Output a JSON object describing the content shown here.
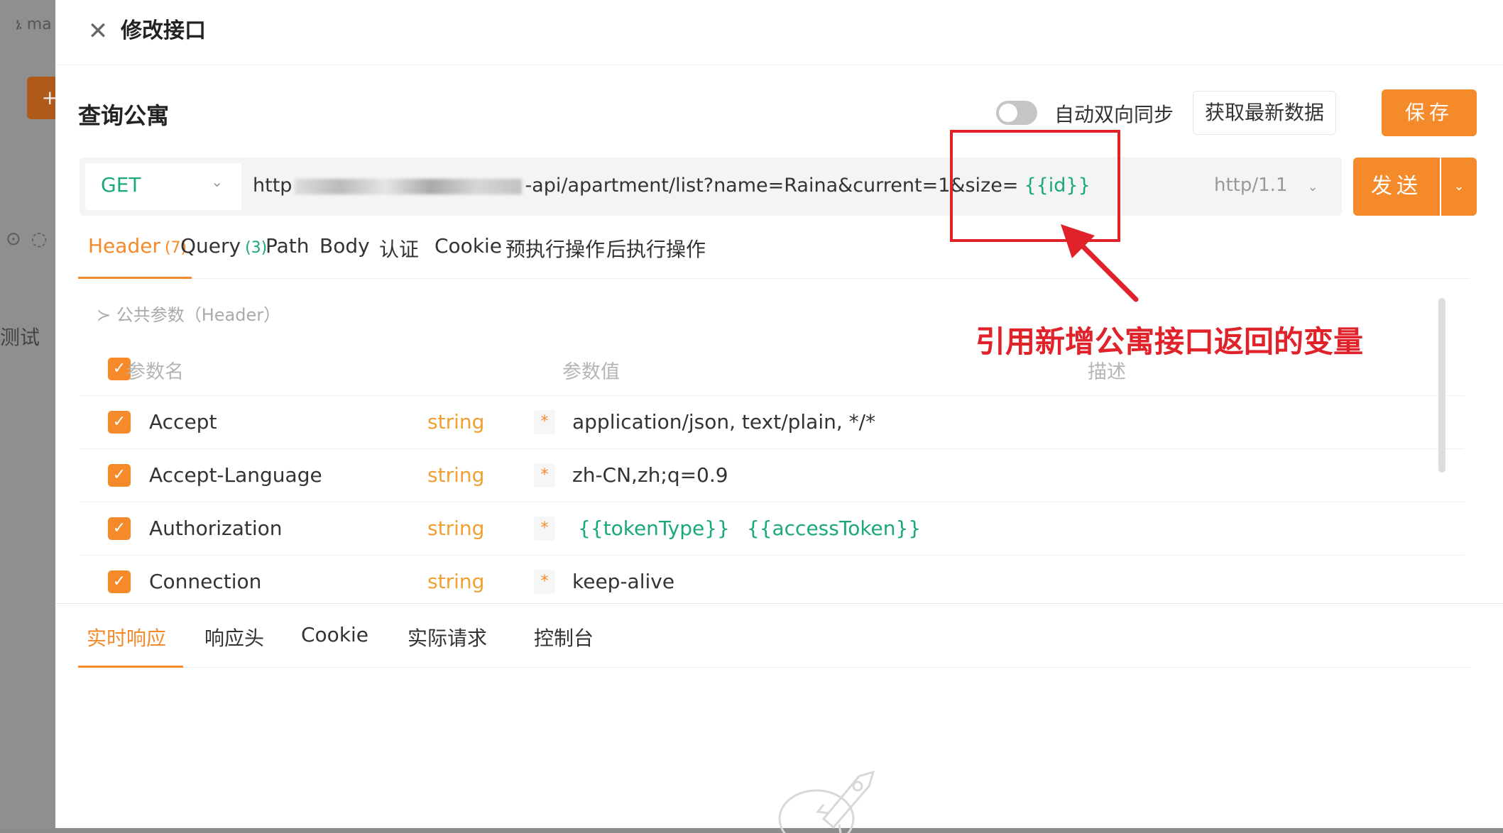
{
  "background": {
    "branch_label": "ma",
    "add_glyph": "+",
    "test_label": "测试",
    "icons": [
      "target-icon",
      "refresh-icon"
    ]
  },
  "drawer": {
    "title": "修改接口",
    "close_glyph": "✕"
  },
  "api": {
    "name": "查询公寓",
    "sync_label": "自动双向同步",
    "sync_on": false,
    "fetch_label": "获取最新数据",
    "save_label": "保存"
  },
  "request": {
    "method": "GET",
    "url_prefix": "http",
    "url_path": "-api/apartment/list?name=Raina&current=1&size=",
    "url_variable": "{{id}}",
    "http_version": "http/1.1",
    "send_label": "发送"
  },
  "tabs": [
    {
      "label": "Header",
      "count": "(7)",
      "active": true
    },
    {
      "label": "Query",
      "count": "(3)"
    },
    {
      "label": "Path"
    },
    {
      "label": "Body"
    },
    {
      "label": "认证"
    },
    {
      "label": "Cookie"
    },
    {
      "label": "预执行操作"
    },
    {
      "label": "后执行操作"
    }
  ],
  "common_params_label": "公共参数（Header）",
  "table": {
    "headers": {
      "name": "参数名",
      "value": "参数值",
      "desc": "描述"
    },
    "rows": [
      {
        "name": "Accept",
        "type": "string",
        "required": "*",
        "value": "application/json, text/plain, */*"
      },
      {
        "name": "Accept-Language",
        "type": "string",
        "required": "*",
        "value": "zh-CN,zh;q=0.9"
      },
      {
        "name": "Authorization",
        "type": "string",
        "required": "*",
        "value_vars": [
          "{{tokenType}}",
          "{{accessToken}}"
        ]
      },
      {
        "name": "Connection",
        "type": "string",
        "required": "*",
        "value": "keep-alive"
      }
    ]
  },
  "response_tabs": [
    {
      "label": "实时响应",
      "active": true
    },
    {
      "label": "响应头"
    },
    {
      "label": "Cookie"
    },
    {
      "label": "实际请求"
    },
    {
      "label": "控制台"
    }
  ],
  "annotation": {
    "text": "引用新增公寓接口返回的变量",
    "color": "#e0222a"
  },
  "colors": {
    "accent": "#f48a29",
    "variable": "#1aa87c",
    "type": "#f0a030"
  }
}
